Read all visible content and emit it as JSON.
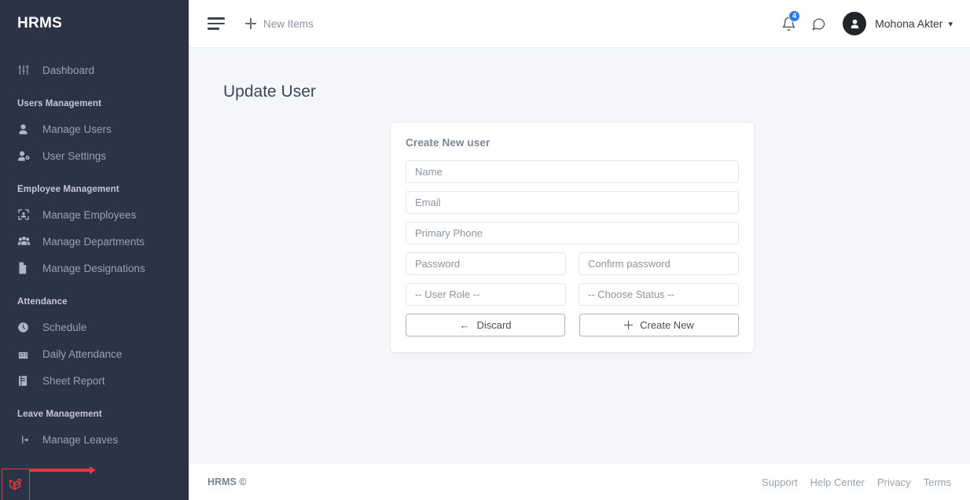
{
  "sidebar": {
    "brand": "HRMS",
    "groups": [
      {
        "label": null,
        "items": [
          {
            "label": "Dashboard",
            "icon": "sliders-icon"
          }
        ]
      },
      {
        "label": "Users Management",
        "items": [
          {
            "label": "Manage Users",
            "icon": "user-icon"
          },
          {
            "label": "User Settings",
            "icon": "user-gear-icon"
          }
        ]
      },
      {
        "label": "Employee Management",
        "items": [
          {
            "label": "Manage Employees",
            "icon": "face-scan-icon"
          },
          {
            "label": "Manage Departments",
            "icon": "users-group-icon"
          },
          {
            "label": "Manage Designations",
            "icon": "document-icon"
          }
        ]
      },
      {
        "label": "Attendance",
        "items": [
          {
            "label": "Schedule",
            "icon": "clock-icon"
          },
          {
            "label": "Daily Attendance",
            "icon": "calendar-icon"
          },
          {
            "label": "Sheet Report",
            "icon": "report-book-icon"
          }
        ]
      },
      {
        "label": "Leave Management",
        "items": [
          {
            "label": "Manage Leaves",
            "icon": "leave-arrow-icon"
          }
        ]
      }
    ],
    "debug_badge": "laravel-logo-icon"
  },
  "topbar": {
    "menu_toggle": "hamburger-icon",
    "new_items_label": "New Items",
    "notification_count": "4",
    "user_name": "Mohona Akter"
  },
  "content": {
    "page_title": "Update User",
    "card": {
      "title": "Create New user",
      "fields": {
        "name_placeholder": "Name",
        "email_placeholder": "Email",
        "phone_placeholder": "Primary Phone",
        "password_placeholder": "Password",
        "confirm_password_placeholder": "Confirm password",
        "role_placeholder": "-- User Role --",
        "status_placeholder": "-- Choose Status --"
      },
      "buttons": {
        "discard": "Discard",
        "create": "Create New"
      }
    }
  },
  "footer": {
    "brand": "HRMS ©",
    "links": [
      "Support",
      "Help Center",
      "Privacy",
      "Terms"
    ]
  },
  "colors": {
    "sidebar_bg": "#2a3446",
    "page_bg": "#f5f6fa",
    "badge_blue": "#2c7be5",
    "debug_red": "#e8383d"
  }
}
